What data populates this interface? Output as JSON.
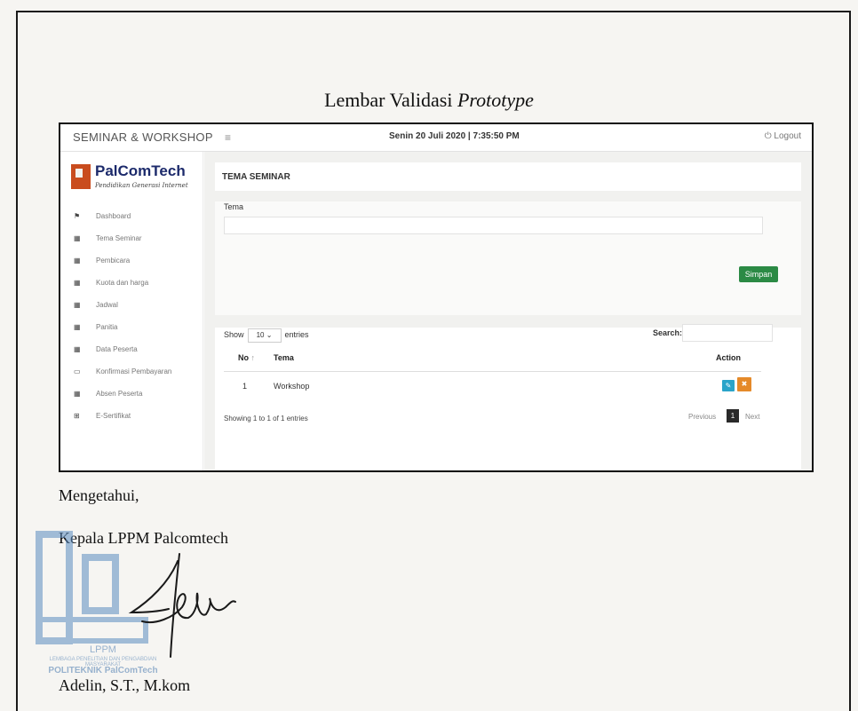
{
  "document": {
    "title_plain": "Lembar Validasi",
    "title_italic": "Prototype",
    "acknowledge": "Mengetahui,",
    "role": "Kepala LPPM Palcomtech",
    "signer": "Adelin, S.T., M.kom",
    "stamp": {
      "line1": "LPPM",
      "line2": "LEMBAGA PENELITIAN DAN PENGABDIAN MASYARAKAT",
      "line3": "POLITEKNIK PalComTech"
    }
  },
  "app": {
    "brand": "SEMINAR & WORKSHOP",
    "menu_icon": "hamburger-icon",
    "datetime": "Senin 20 Juli 2020 | 7:35:50 PM",
    "logout_label": "Logout",
    "logo": {
      "name": "PalComTech",
      "tagline": "Pendidikan Generasi Internet"
    }
  },
  "sidebar": {
    "items": [
      {
        "icon": "dashboard-icon",
        "glyph": "⚑",
        "label": "Dashboard"
      },
      {
        "icon": "calendar-icon",
        "glyph": "▦",
        "label": "Tema Seminar"
      },
      {
        "icon": "calendar-icon",
        "glyph": "▦",
        "label": "Pembicara"
      },
      {
        "icon": "calendar-icon",
        "glyph": "▦",
        "label": "Kuota dan harga"
      },
      {
        "icon": "calendar-icon",
        "glyph": "▦",
        "label": "Jadwal"
      },
      {
        "icon": "calendar-icon",
        "glyph": "▦",
        "label": "Panitia"
      },
      {
        "icon": "calendar-icon",
        "glyph": "▦",
        "label": "Data Peserta"
      },
      {
        "icon": "card-icon",
        "glyph": "▭",
        "label": "Konfirmasi Pembayaran"
      },
      {
        "icon": "calendar-icon",
        "glyph": "▦",
        "label": "Absen Peserta"
      },
      {
        "icon": "certificate-icon",
        "glyph": "⊞",
        "label": "E-Sertifikat"
      }
    ]
  },
  "main": {
    "section_title": "TEMA SEMINAR",
    "form": {
      "field_label": "Tema",
      "field_value": "",
      "save_label": "Simpan"
    },
    "table": {
      "show_label": "Show",
      "entries_value": "10",
      "entries_label": "entries",
      "search_label": "Search:",
      "search_value": "",
      "columns": [
        "No",
        "Tema",
        "Action"
      ],
      "rows": [
        {
          "no": "1",
          "tema": "Workshop"
        }
      ],
      "info": "Showing 1 to 1 of 1 entries",
      "previous_label": "Previous",
      "current_page": "1",
      "next_label": "Next"
    }
  }
}
